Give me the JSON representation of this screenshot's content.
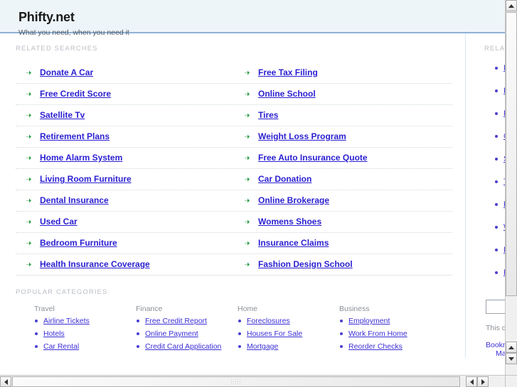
{
  "header": {
    "site_title": "Phifty.net",
    "tagline": "What you need, when you need it"
  },
  "main": {
    "related_searches_label": "RELATED SEARCHES",
    "popular_categories_label": "POPULAR CATEGORIES",
    "related_searches": [
      {
        "left": "Donate A Car",
        "right": "Free Tax Filing"
      },
      {
        "left": "Free Credit Score",
        "right": "Online School"
      },
      {
        "left": "Satellite Tv",
        "right": "Tires"
      },
      {
        "left": "Retirement Plans",
        "right": "Weight Loss Program"
      },
      {
        "left": "Home Alarm System",
        "right": "Free Auto Insurance Quote"
      },
      {
        "left": "Living Room Furniture",
        "right": "Car Donation"
      },
      {
        "left": "Dental Insurance",
        "right": "Online Brokerage"
      },
      {
        "left": "Used Car",
        "right": "Womens Shoes"
      },
      {
        "left": "Bedroom Furniture",
        "right": "Insurance Claims"
      },
      {
        "left": "Health Insurance Coverage",
        "right": "Fashion Design School"
      }
    ],
    "categories": [
      {
        "heading": "Travel",
        "links": [
          "Airline Tickets",
          "Hotels",
          "Car Rental"
        ]
      },
      {
        "heading": "Finance",
        "links": [
          "Free Credit Report",
          "Online Payment",
          "Credit Card Application"
        ]
      },
      {
        "heading": "Home",
        "links": [
          "Foreclosures",
          "Houses For Sale",
          "Mortgage"
        ]
      },
      {
        "heading": "Business",
        "links": [
          "Employment",
          "Work From Home",
          "Reorder Checks"
        ]
      }
    ]
  },
  "sidebar": {
    "label": "RELATED SEARCHES",
    "links": [
      "Donate A Car",
      "Free Credit Score",
      "Free Tax Filing",
      "Online School",
      "Satellite Tv",
      "Tires",
      "Retirement Plans",
      "Weight Loss Program",
      "Home Alarm System",
      "Free Auto Insurance Quote"
    ],
    "search_value": "",
    "search_placeholder": "",
    "note": "This domain may be for sale",
    "bookmark_label": "Bookmark this page",
    "make_home_label": "Make this my home page"
  },
  "scrollbars": {
    "vertical_up_icon": "triangle-up-icon",
    "vertical_down_icon": "triangle-down-icon",
    "horizontal_left_icon": "triangle-left-icon",
    "horizontal_right_icon": "triangle-right-icon"
  },
  "colors": {
    "header_bg": "#eef5f8",
    "header_border": "#8fb0d6",
    "link": "#2a1fd1",
    "bullet_green": "#2f9e44",
    "label_gray": "#b9bec4"
  }
}
